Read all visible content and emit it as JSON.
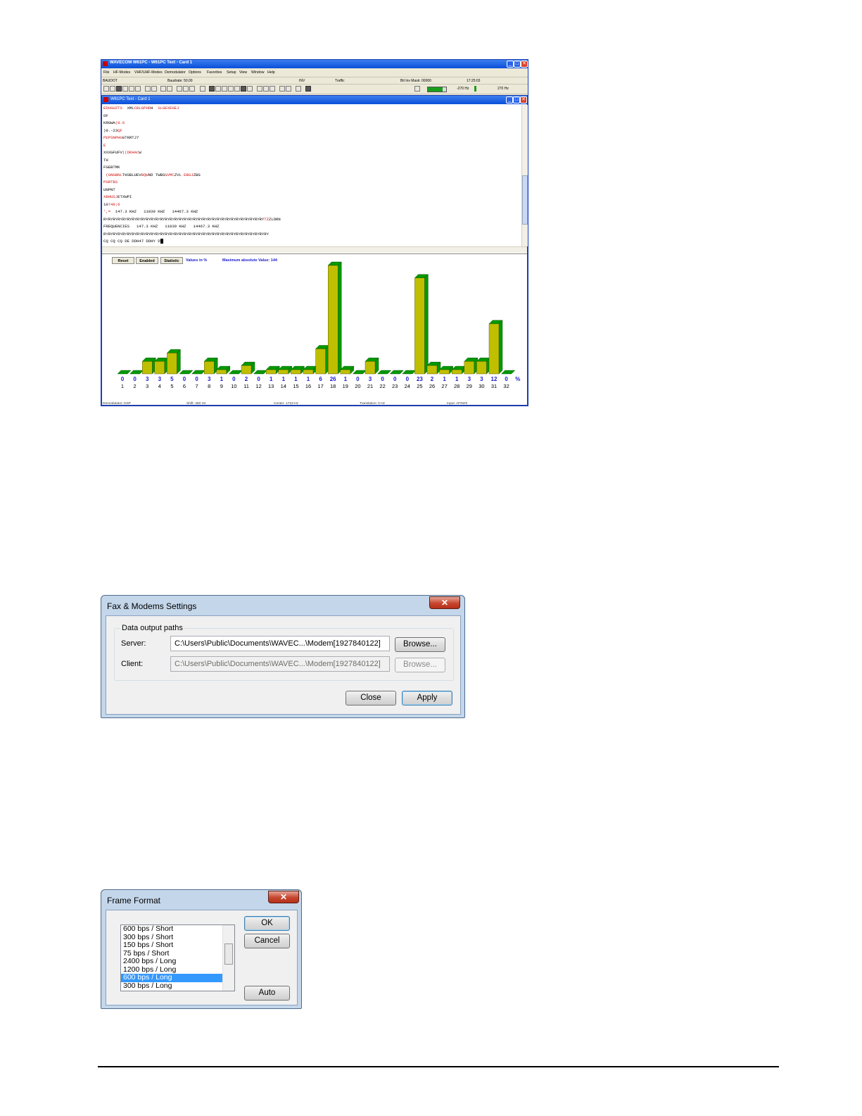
{
  "wavecom": {
    "title": "WAVECOM W61PC - W61PC Text - Card 1",
    "menu": [
      "File",
      "HF-Modes",
      "VHF/UHF-Modes",
      "Demodulator",
      "Options",
      "Favorites",
      "Setup",
      "View",
      "Window",
      "Help"
    ],
    "status": {
      "mode": "BAUDOT",
      "baudrate": "Baudrate: 50.00",
      "inv": "INV",
      "traffic": "Traffic",
      "bitmask": "Bit Inv Mask: 00000",
      "time": "17:25:03"
    },
    "toolbar": {
      "left_hz": "-270 Hz",
      "right_hz": "270 Hz"
    },
    "child_title": "W61PC Text - Card 1",
    "text_lines": [
      [
        {
          "t": "EDUGUZTS",
          "r": true
        },
        {
          "t": "  XML",
          "r": false
        },
        {
          "t": "CBLGPHD",
          "r": true
        },
        {
          "t": "H  ",
          "r": false
        },
        {
          "t": "SLGEXEGEJ",
          "r": true
        }
      ],
      [
        {
          "t": "OF",
          "r": false
        }
      ],
      [
        {
          "t": "KRGWA",
          "r": false
        },
        {
          "t": "(8.6",
          "r": true
        }
      ],
      [
        {
          "t": ")9.-23",
          "r": false
        },
        {
          "t": "QF",
          "r": true
        }
      ],
      [
        {
          "t": "PEPSNPHG",
          "r": true
        },
        {
          "t": "GTKRTJ7",
          "r": false
        }
      ],
      [
        {
          "t": "E",
          "r": true
        }
      ],
      [
        {
          "t": "XXXGFUFV",
          "r": false
        },
        {
          "t": "((DKHAC",
          "r": true
        },
        {
          "t": "W",
          "r": false
        }
      ],
      [
        {
          "t": "TH",
          "r": false
        }
      ],
      [
        {
          "t": "FGEBTMK",
          "r": false
        }
      ],
      [
        {
          "t": " (GNGBNL",
          "r": true
        },
        {
          "t": "THSBLUEV",
          "r": false
        },
        {
          "t": "BQW",
          "r": true
        },
        {
          "t": "ND TWBS",
          "r": false
        },
        {
          "t": "GVMC",
          "r": true
        },
        {
          "t": "ZVL ",
          "r": false
        },
        {
          "t": "EBGJ",
          "r": true
        },
        {
          "t": "ZBG",
          "r": false
        }
      ],
      [
        {
          "t": "PGRTBS",
          "r": true
        }
      ],
      [
        {
          "t": "UNPNT",
          "r": false
        }
      ],
      [
        {
          "t": "XBHUSJ",
          "r": true
        },
        {
          "t": "ETXWPI",
          "r": false
        }
      ],
      [
        {
          "t": "10",
          "r": false
        },
        {
          "t": "749;6",
          "r": true
        }
      ],
      [
        {
          "t": "',=",
          "r": true
        },
        {
          "t": "  147.3 KHZ   11039 KHZ   14467.3 KHZ",
          "r": false
        }
      ],
      [
        {
          "t": "RYRYRYRYRYRYRYRYRYRYRYRYRYRYRYRYRYRYRYRYRYRYRYRYRYRYRYRYRYRYRYRYRYRY",
          "r": false
        },
        {
          "t": "TZ",
          "r": true
        },
        {
          "t": "ZLDRN",
          "r": false
        }
      ],
      [
        {
          "t": "FREQUENCIES   147.3 KHZ   11039 KHZ   14467.3 KHZ",
          "r": false
        }
      ],
      [
        {
          "t": "RYRYRYRYRYRYRYRYRYRYRYRYRYRYRYRYRYRYRYRYRYRYRYRYRYRYRYRYRYRYRYRYRYRYRY",
          "r": false
        }
      ],
      [
        {
          "t": "CQ CQ CQ DE DDH47 DDHY D",
          "r": false
        }
      ]
    ],
    "chart_controls": {
      "reset": "Reset",
      "enabled": "Enabled",
      "statistic": "Statistic",
      "values_label": "Values in %",
      "max_label": "Maximum absolute Value: 144"
    },
    "bottom_status": {
      "demod": "Demodulator: DSP",
      "shift": "Shift: 450 Hz",
      "center": "Center: 1718 Hz",
      "translation": "Translation: 0 Hz",
      "input": "Input: AFIN#2"
    }
  },
  "chart_data": {
    "type": "bar",
    "categories": [
      "1",
      "2",
      "3",
      "4",
      "5",
      "6",
      "7",
      "8",
      "9",
      "10",
      "11",
      "12",
      "13",
      "14",
      "15",
      "16",
      "17",
      "18",
      "19",
      "20",
      "21",
      "22",
      "23",
      "24",
      "25",
      "26",
      "27",
      "28",
      "29",
      "30",
      "31",
      "32"
    ],
    "values": [
      0,
      0,
      3,
      3,
      5,
      0,
      0,
      3,
      1,
      0,
      2,
      0,
      1,
      1,
      1,
      1,
      6,
      26,
      1,
      0,
      3,
      0,
      0,
      0,
      23,
      2,
      1,
      1,
      3,
      3,
      12,
      0
    ],
    "unit_label": "%",
    "colors": {
      "bar_front": "#bfbf00",
      "bar_side": "#009900",
      "label": "#1a1acd"
    }
  },
  "fax_dialog": {
    "title": "Fax & Modems Settings",
    "close_glyph": "✕",
    "group_label": "Data output paths",
    "server_label": "Server:",
    "server_path": "C:\\Users\\Public\\Documents\\WAVEC...\\Modem[1927840122]",
    "client_label": "Client:",
    "client_path": "C:\\Users\\Public\\Documents\\WAVEC...\\Modem[1927840122]",
    "browse_label": "Browse...",
    "browse_disabled_label": "Browse...",
    "close_label": "Close",
    "apply_label": "Apply"
  },
  "frame_dialog": {
    "title": "Frame Format",
    "close_glyph": "✕",
    "items": [
      "600 bps / Short",
      "300 bps / Short",
      "150 bps / Short",
      "75 bps / Short",
      "2400 bps / Long",
      "1200 bps / Long",
      "600 bps / Long",
      "300 bps / Long"
    ],
    "selected_index": 6,
    "ok_label": "OK",
    "cancel_label": "Cancel",
    "auto_label": "Auto"
  }
}
